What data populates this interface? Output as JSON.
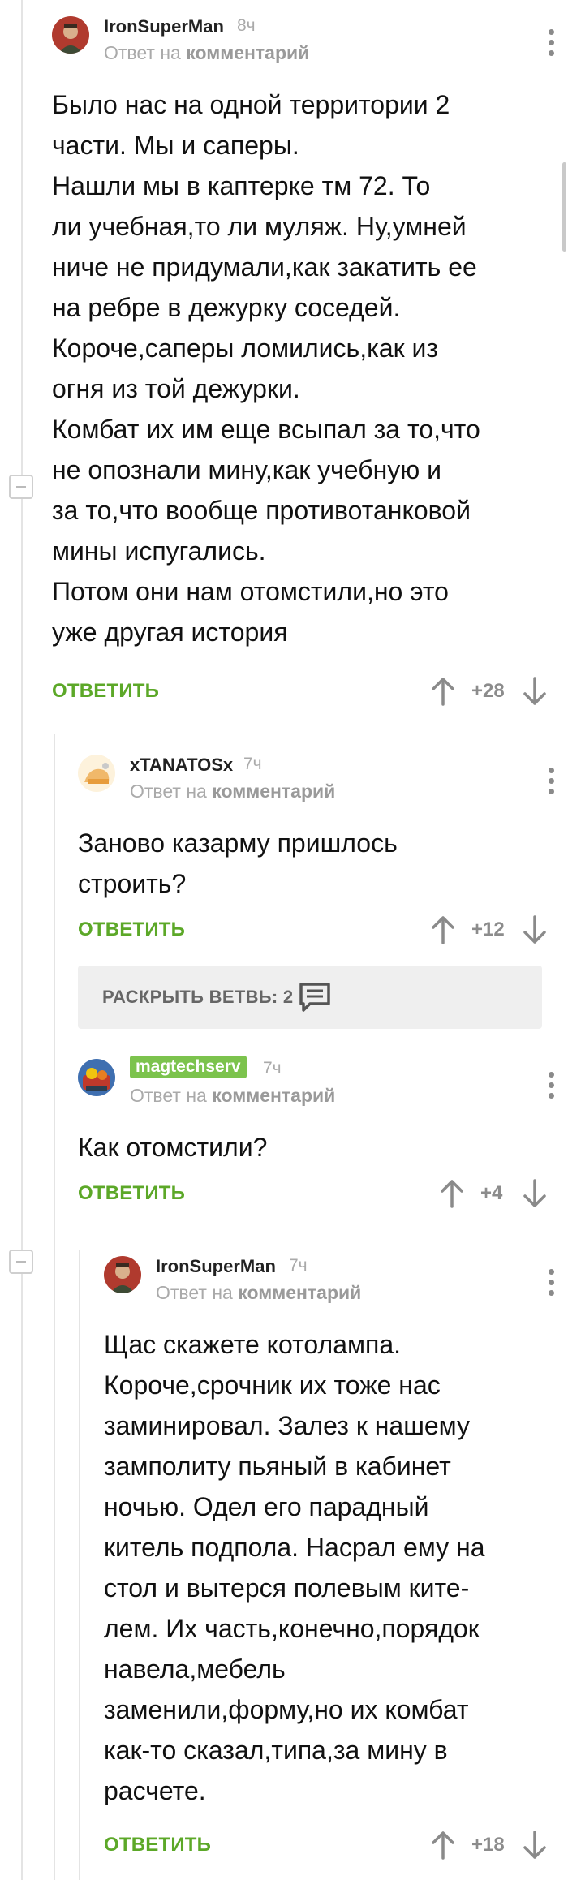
{
  "colors": {
    "accent_green": "#5ca828",
    "badge_green": "#7cc34d",
    "muted": "#aaaaaa"
  },
  "comments": [
    {
      "username": "IronSuperMan",
      "time": "8ч",
      "subline_prefix": "Ответ на",
      "subline_link": "комментарий",
      "body_lines": [
        "Было нас на одной территории 2",
        "части. Мы и саперы.",
        "Нашли мы в каптерке тм 72. То",
        "ли учебная,то ли муляж. Ну,умней",
        "ниче не придумали,как закатить ее",
        "на ребре в дежурку соседей.",
        "Короче,саперы ломились,как из",
        "огня из той дежурки.",
        "Комбат их им еще всыпал за то,что",
        "не опознали мину,как учебную и",
        "за то,что вообще противотанковой",
        "мины испугались.",
        "Потом они нам отомстили,но это",
        "уже другая история"
      ],
      "reply_label": "ОТВЕТИТЬ",
      "score": "+28"
    },
    {
      "username": "xTANATOSx",
      "time": "7ч",
      "subline_prefix": "Ответ на",
      "subline_link": "комментарий",
      "body_lines": [
        "Заново казарму пришлось",
        "строить?"
      ],
      "reply_label": "ОТВЕТИТЬ",
      "score": "+12"
    },
    {
      "username": "magtechserv",
      "time": "7ч",
      "subline_prefix": "Ответ на",
      "subline_link": "комментарий",
      "body_lines": [
        "Как отомстили?"
      ],
      "reply_label": "ОТВЕТИТЬ",
      "score": "+4"
    },
    {
      "username": "IronSuperMan",
      "time": "7ч",
      "subline_prefix": "Ответ на",
      "subline_link": "комментарий",
      "body_lines": [
        "Щас скажете котолампа.",
        "Короче,срочник их тоже нас",
        "заминировал. Залез к нашему",
        "замполиту пьяный в кабинет",
        "ночью. Одел его парадный",
        "китель подпола. Насрал ему на",
        "стол и вытерся полевым ките-",
        "лем. Их часть,конечно,порядок",
        "навела,мебель",
        "заменили,форму,но их комбат",
        "как-то сказал,типа,за мину в",
        "расчете."
      ],
      "reply_label": "ОТВЕТИТЬ",
      "score": "+18"
    }
  ],
  "branch": {
    "label": "РАСКРЫТЬ ВЕТВЬ: 2"
  },
  "icons": [
    "more-vertical-icon",
    "arrow-up-icon",
    "arrow-down-icon",
    "comments-icon",
    "collapse-icon"
  ]
}
